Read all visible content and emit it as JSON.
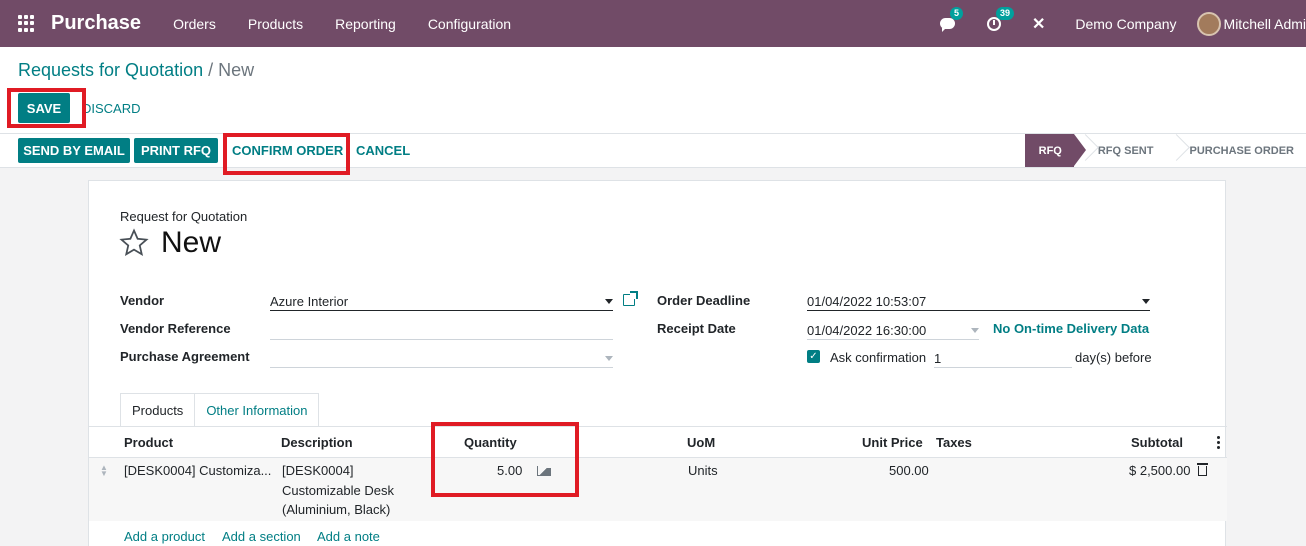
{
  "navbar": {
    "brand": "Purchase",
    "menu": [
      "Orders",
      "Products",
      "Reporting",
      "Configuration"
    ],
    "messages_count": "5",
    "activities_count": "39",
    "company": "Demo Company",
    "user": "Mitchell Admi"
  },
  "breadcrumb": {
    "parent": "Requests for Quotation",
    "separator": "/",
    "current": "New"
  },
  "buttons": {
    "save": "SAVE",
    "discard": "DISCARD",
    "send_email": "SEND BY EMAIL",
    "print_rfq": "PRINT RFQ",
    "confirm_order": "CONFIRM ORDER",
    "cancel": "CANCEL"
  },
  "statusbar": [
    "RFQ",
    "RFQ SENT",
    "PURCHASE ORDER"
  ],
  "form": {
    "subtitle": "Request for Quotation",
    "name": "New",
    "vendor_label": "Vendor",
    "vendor_value": "Azure Interior",
    "vendor_ref_label": "Vendor Reference",
    "vendor_ref_value": "",
    "agreement_label": "Purchase Agreement",
    "agreement_value": "",
    "deadline_label": "Order Deadline",
    "deadline_value": "01/04/2022 10:53:07",
    "receipt_label": "Receipt Date",
    "receipt_value": "01/04/2022 16:30:00",
    "on_time_link": "No On-time Delivery Data",
    "ask_confirmation_label": "Ask confirmation",
    "ask_confirmation_days": "1",
    "days_before": "day(s) before"
  },
  "tabs": [
    "Products",
    "Other Information"
  ],
  "table": {
    "headers": {
      "product": "Product",
      "description": "Description",
      "quantity": "Quantity",
      "uom": "UoM",
      "unit_price": "Unit Price",
      "taxes": "Taxes",
      "subtotal": "Subtotal"
    },
    "row": {
      "product": "[DESK0004] Customiza...",
      "description_line1": "[DESK0004]",
      "description_line2": "Customizable Desk",
      "description_line3": "(Aluminium, Black)",
      "quantity": "5.00",
      "uom": "Units",
      "unit_price": "500.00",
      "taxes": "",
      "subtotal": "$ 2,500.00"
    },
    "add_product": "Add a product",
    "add_section": "Add a section",
    "add_note": "Add a note"
  },
  "colors": {
    "brand": "#714b67",
    "primary": "#017e84",
    "highlight": "#e01b24"
  },
  "icons": [
    "apps-icon",
    "chat-icon",
    "clock-icon",
    "tools-icon",
    "star-icon",
    "external-link-icon",
    "forecast-chart-icon",
    "trash-icon",
    "kebab-icon",
    "drag-handle-icon"
  ]
}
